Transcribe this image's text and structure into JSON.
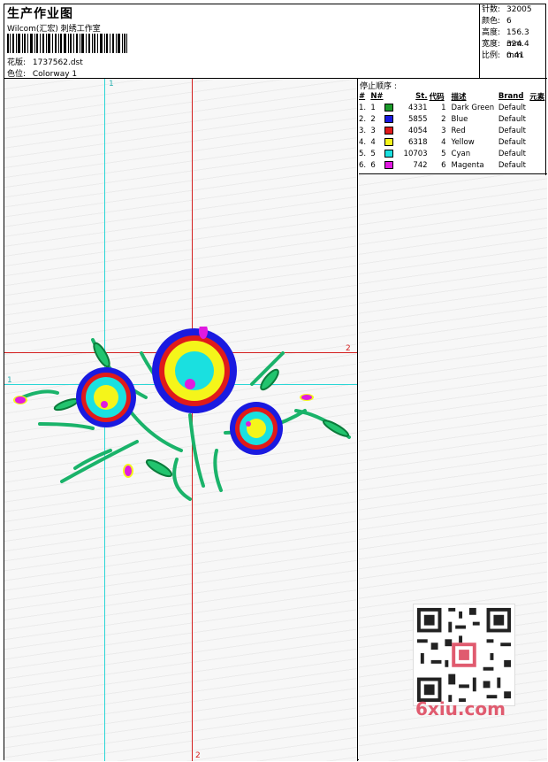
{
  "header": {
    "title": "生产作业图",
    "subtitle": "Wilcom(汇宏) 刺绣工作室",
    "file_label": "花版:",
    "file_value": "1737562.dst",
    "colorway_label": "色位:",
    "colorway_value": "Colorway 1"
  },
  "stats": [
    {
      "label": "针数:",
      "value": "32005"
    },
    {
      "label": "颜色:",
      "value": "6"
    },
    {
      "label": "高度:",
      "value": "156.3 mm"
    },
    {
      "label": "宽度:",
      "value": "324.4 mm"
    },
    {
      "label": "比例:",
      "value": "0.41"
    }
  ],
  "color_table": {
    "heading": "停止顺序 :",
    "columns": [
      "#",
      "N#",
      "St.",
      "代码",
      "描述",
      "Brand",
      "元素"
    ],
    "rows": [
      {
        "idx": "1.",
        "n": "1",
        "color": "#1a9a2a",
        "st": "4331",
        "code": "1",
        "desc": "Dark Green",
        "brand": "Default"
      },
      {
        "idx": "2.",
        "n": "2",
        "color": "#1a1ae0",
        "st": "5855",
        "code": "2",
        "desc": "Blue",
        "brand": "Default"
      },
      {
        "idx": "3.",
        "n": "3",
        "color": "#e01a1a",
        "st": "4054",
        "code": "3",
        "desc": "Red",
        "brand": "Default"
      },
      {
        "idx": "4.",
        "n": "4",
        "color": "#f5f51a",
        "st": "6318",
        "code": "4",
        "desc": "Yellow",
        "brand": "Default"
      },
      {
        "idx": "5.",
        "n": "5",
        "color": "#1ae0e0",
        "st": "10703",
        "code": "5",
        "desc": "Cyan",
        "brand": "Default"
      },
      {
        "idx": "6.",
        "n": "6",
        "color": "#e01ae0",
        "st": "742",
        "code": "6",
        "desc": "Magenta",
        "brand": "Default"
      }
    ]
  },
  "guides": {
    "cyan_label": "1",
    "red_label": "2"
  },
  "watermark": "6xiu.com"
}
